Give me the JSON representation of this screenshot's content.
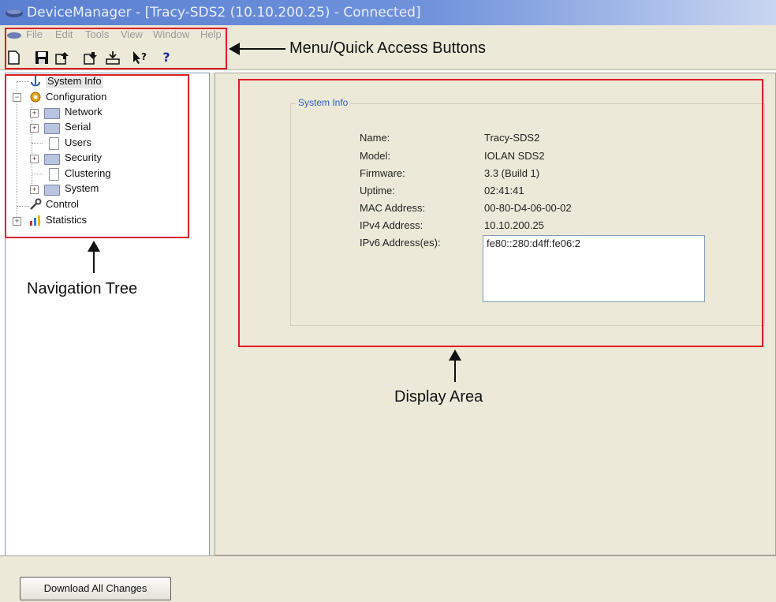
{
  "window": {
    "title": "DeviceManager - [Tracy-SDS2 (10.10.200.25) - Connected]"
  },
  "menu": [
    "File",
    "Edit",
    "Tools",
    "View",
    "Window",
    "Help"
  ],
  "tree": {
    "system_info": "System Info",
    "configuration": "Configuration",
    "network": "Network",
    "serial": "Serial",
    "users": "Users",
    "security": "Security",
    "clustering": "Clustering",
    "system": "System",
    "control": "Control",
    "statistics": "Statistics"
  },
  "system_info": {
    "group_title": "System Info",
    "fields": [
      {
        "label": "Name:",
        "value": "Tracy-SDS2"
      },
      {
        "label": "Model:",
        "value": "IOLAN SDS2"
      },
      {
        "label": "Firmware:",
        "value": "3.3 (Build 1)"
      },
      {
        "label": "Uptime:",
        "value": "02:41:41"
      },
      {
        "label": "MAC Address:",
        "value": "00-80-D4-06-00-02"
      },
      {
        "label": "IPv4 Address:",
        "value": "10.10.200.25"
      },
      {
        "label": "IPv6 Address(es):",
        "value": "fe80::280:d4ff:fe06:2"
      }
    ]
  },
  "bottom": {
    "download_button": "Download All Changes"
  },
  "annotations": {
    "menu_quick": "Menu/Quick Access Buttons",
    "nav_tree": "Navigation Tree",
    "display_area": "Display Area"
  },
  "colors": {
    "highlight_red": "#e01b24",
    "group_title_blue": "#2c5cc5",
    "window_bg": "#ece9d8"
  }
}
